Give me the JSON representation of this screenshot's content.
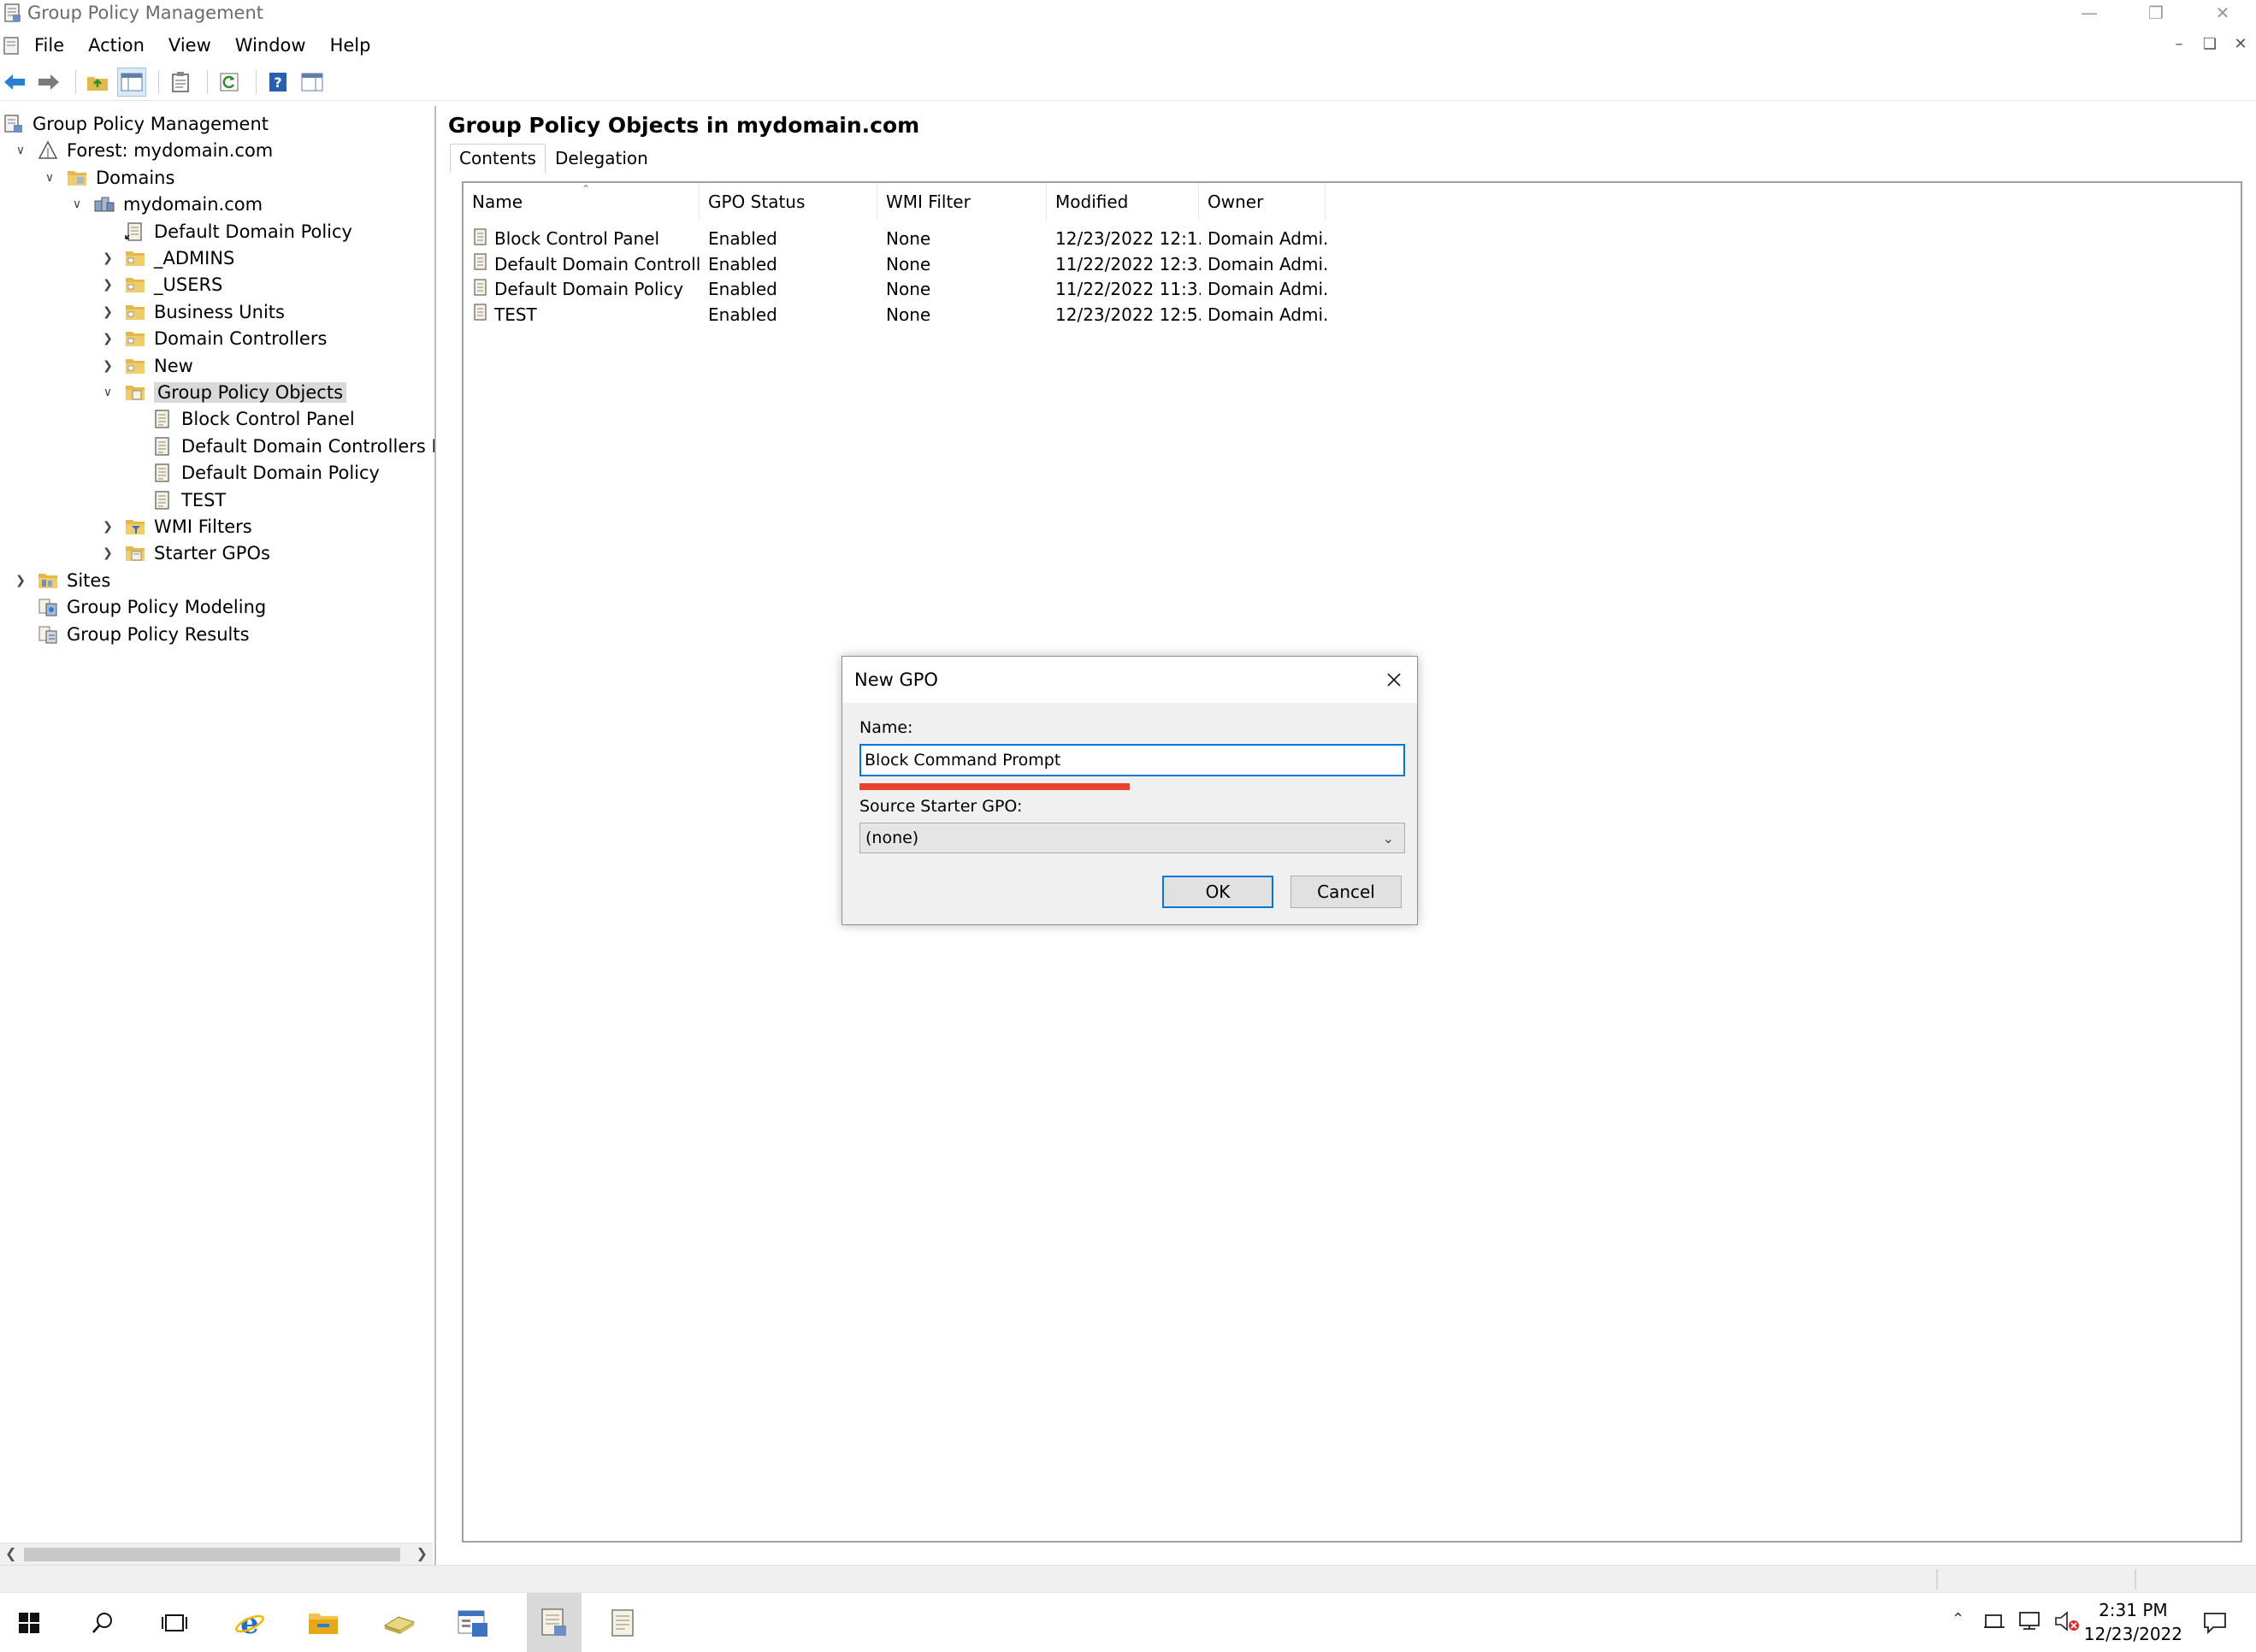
{
  "window": {
    "title": "Group Policy Management"
  },
  "menu": [
    "File",
    "Action",
    "View",
    "Window",
    "Help"
  ],
  "tree": [
    {
      "label": "Group Policy Management",
      "icon": "gpm-icon",
      "level": 0,
      "tw": ""
    },
    {
      "label": "Forest: mydomain.com",
      "icon": "forest-icon",
      "level": 1,
      "tw": "v"
    },
    {
      "label": "Domains",
      "icon": "folder-icon",
      "level": 2,
      "tw": "v"
    },
    {
      "label": "mydomain.com",
      "icon": "domain-icon",
      "level": 3,
      "tw": "v"
    },
    {
      "label": "Default Domain Policy",
      "icon": "gpo-link-icon",
      "level": 4,
      "tw": ""
    },
    {
      "label": "_ADMINS",
      "icon": "ou-folder-icon",
      "level": 4,
      "tw": ">"
    },
    {
      "label": "_USERS",
      "icon": "ou-folder-icon",
      "level": 4,
      "tw": ">"
    },
    {
      "label": "Business Units",
      "icon": "ou-folder-icon",
      "level": 4,
      "tw": ">"
    },
    {
      "label": "Domain Controllers",
      "icon": "ou-folder-icon",
      "level": 4,
      "tw": ">"
    },
    {
      "label": "New",
      "icon": "ou-folder-icon",
      "level": 4,
      "tw": ">"
    },
    {
      "label": "Group Policy Objects",
      "icon": "gpo-folder-icon",
      "level": 4,
      "tw": "v",
      "selected": true
    },
    {
      "label": "Block Control Panel",
      "icon": "gpo-icon",
      "level": 5,
      "tw": ""
    },
    {
      "label": "Default Domain Controllers Policy",
      "icon": "gpo-icon",
      "level": 5,
      "tw": ""
    },
    {
      "label": "Default Domain Policy",
      "icon": "gpo-icon",
      "level": 5,
      "tw": ""
    },
    {
      "label": "TEST",
      "icon": "gpo-icon",
      "level": 5,
      "tw": ""
    },
    {
      "label": "WMI Filters",
      "icon": "wmi-folder-icon",
      "level": 4,
      "tw": ">"
    },
    {
      "label": "Starter GPOs",
      "icon": "starter-folder-icon",
      "level": 4,
      "tw": ">"
    },
    {
      "label": "Sites",
      "icon": "sites-icon",
      "level": 1,
      "tw": ">"
    },
    {
      "label": "Group Policy Modeling",
      "icon": "modeling-icon",
      "level": 1,
      "tw": ""
    },
    {
      "label": "Group Policy Results",
      "icon": "results-icon",
      "level": 1,
      "tw": ""
    }
  ],
  "right": {
    "title": "Group Policy Objects in mydomain.com",
    "tabs": [
      "Contents",
      "Delegation"
    ],
    "columns": [
      "Name",
      "GPO Status",
      "WMI Filter",
      "Modified",
      "Owner"
    ],
    "rows": [
      [
        "Block Control Panel",
        "Enabled",
        "None",
        "12/23/2022 12:1...",
        "Domain Admi..."
      ],
      [
        "Default Domain Controller...",
        "Enabled",
        "None",
        "11/22/2022 12:3...",
        "Domain Admi..."
      ],
      [
        "Default Domain Policy",
        "Enabled",
        "None",
        "11/22/2022 11:3...",
        "Domain Admi..."
      ],
      [
        "TEST",
        "Enabled",
        "None",
        "12/23/2022 12:5...",
        "Domain Admi..."
      ]
    ]
  },
  "dialog": {
    "title": "New GPO",
    "name_label": "Name:",
    "name_value": "Block Command Prompt",
    "starter_label": "Source Starter GPO:",
    "starter_value": "(none)",
    "ok": "OK",
    "cancel": "Cancel",
    "accent": "#0078d7",
    "error_color": "#e8432c"
  },
  "taskbar": {
    "time": "2:31 PM",
    "date": "12/23/2022"
  }
}
